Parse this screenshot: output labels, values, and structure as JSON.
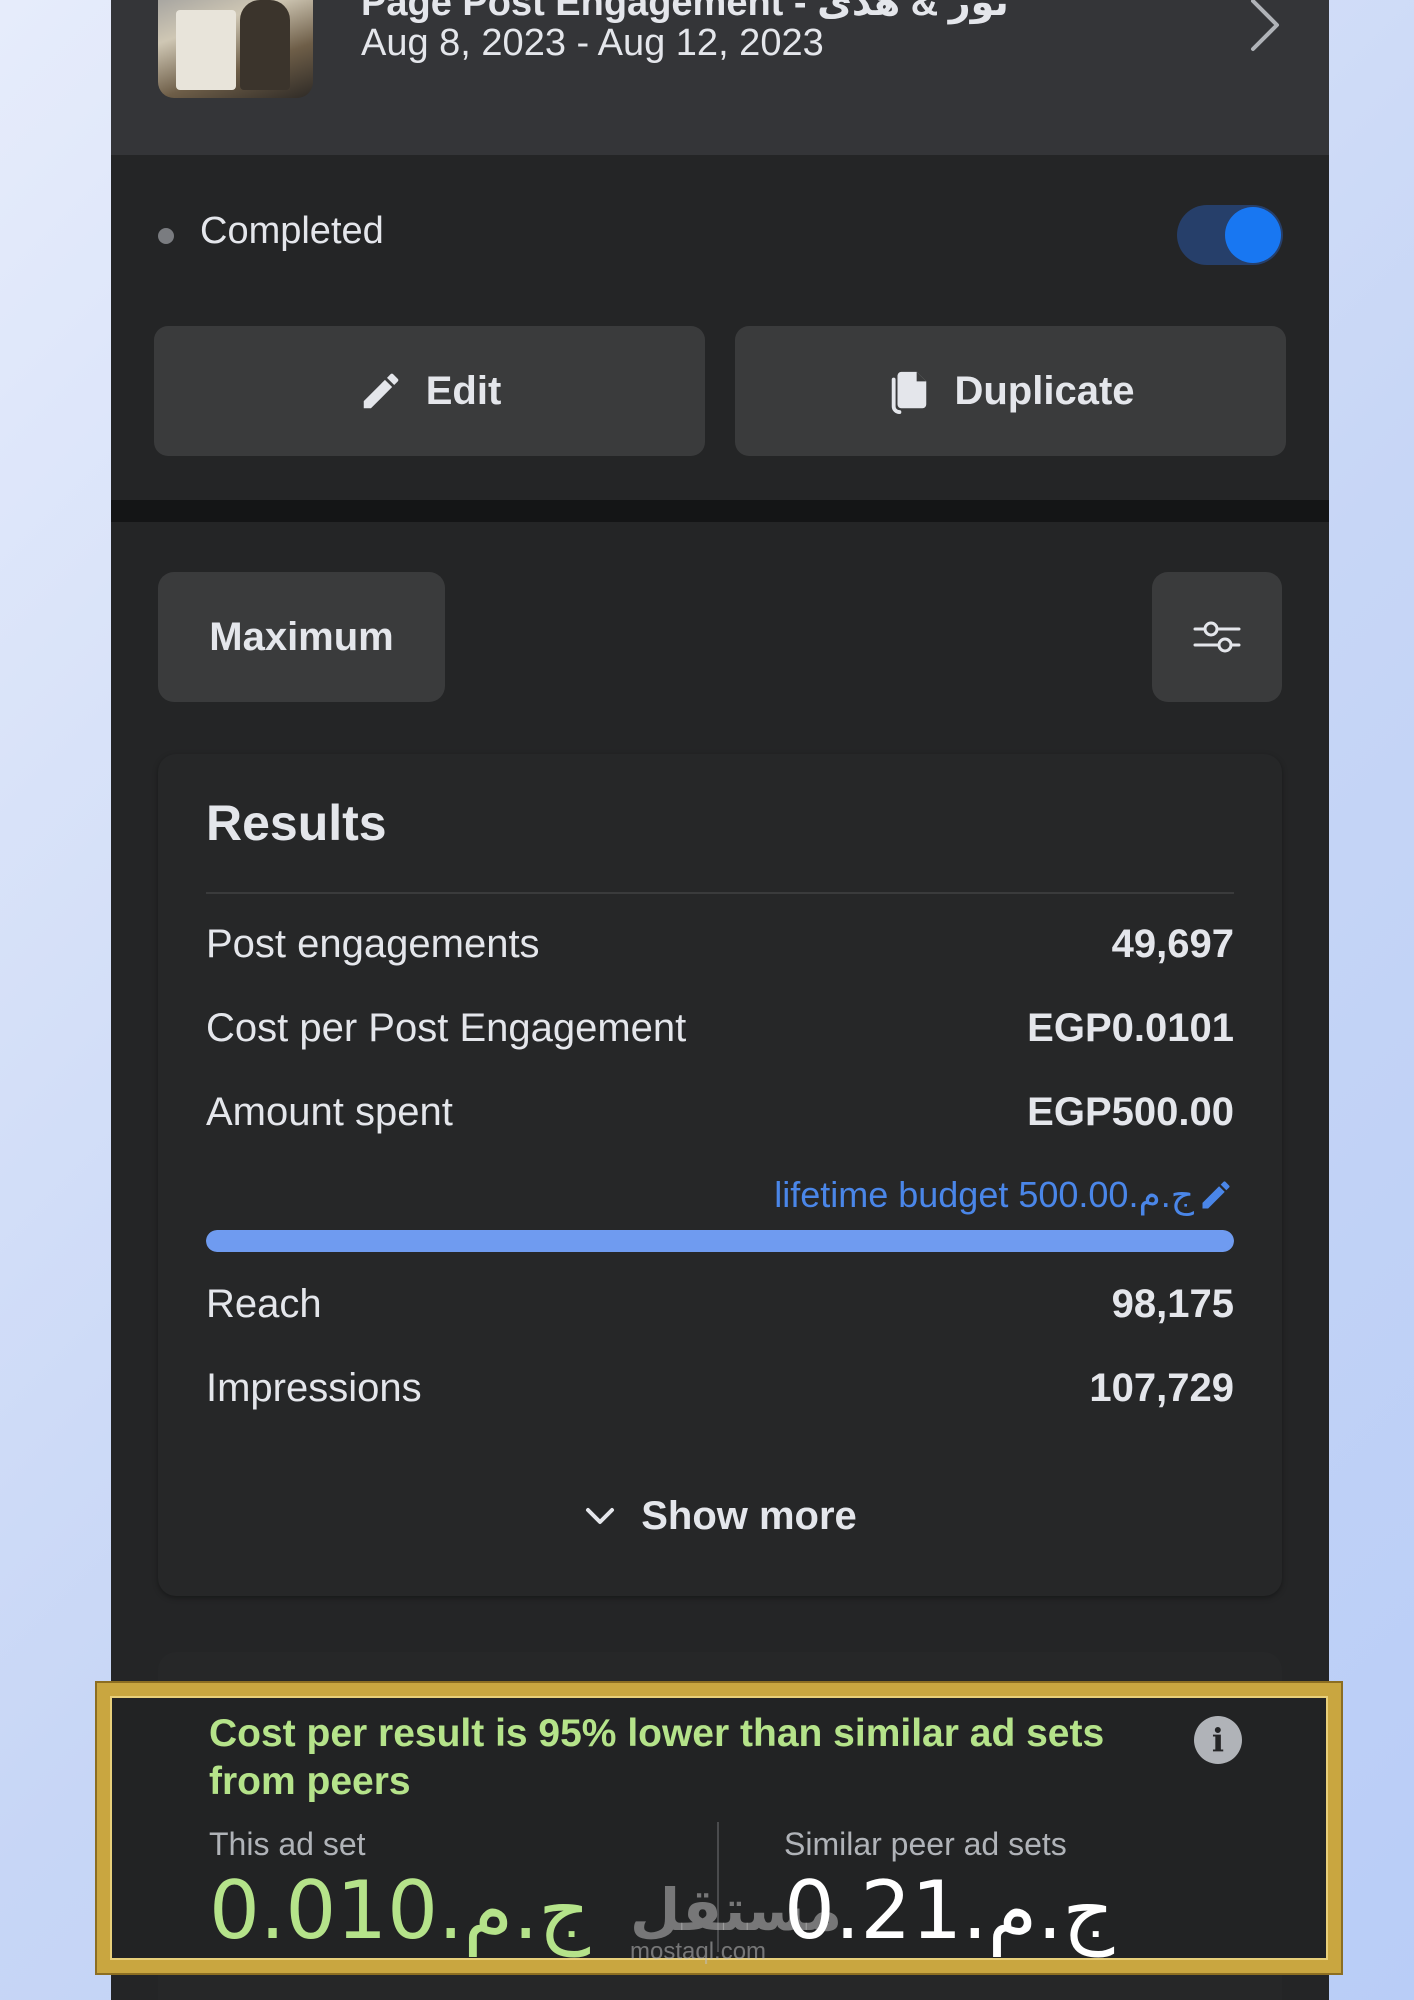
{
  "header": {
    "title": "Page Post Engagement - نور & هدى",
    "date_range": "Aug 8, 2023 - Aug 12, 2023"
  },
  "status": {
    "label": "Completed",
    "toggle_on": true
  },
  "actions": {
    "edit_label": "Edit",
    "duplicate_label": "Duplicate"
  },
  "filter": {
    "range_label": "Maximum",
    "settings_icon": "sliders-icon"
  },
  "results": {
    "title": "Results",
    "rows": [
      {
        "label": "Post engagements",
        "value": "49,697"
      },
      {
        "label": "Cost per Post Engagement",
        "value": "EGP0.0101"
      },
      {
        "label": "Amount spent",
        "value": "EGP500.00"
      }
    ],
    "budget_text": "lifetime budget 500.00.ج.م",
    "budget_progress": 1.0,
    "rows2": [
      {
        "label": "Reach",
        "value": "98,175"
      },
      {
        "label": "Impressions",
        "value": "107,729"
      }
    ],
    "show_more": "Show more"
  },
  "peer": {
    "headline": "Cost per result is 95% lower than similar ad sets from peers",
    "this_label": "This ad set",
    "this_value": "0.010.ج.م",
    "peer_label": "Similar peer ad sets",
    "peer_value": "0.21.ج.م",
    "info_icon": "info-icon"
  },
  "watermark": {
    "text": "مستقل",
    "domain": "mostaql.com"
  },
  "colors": {
    "accent": "#1877f2",
    "link": "#4a86e8",
    "positive": "#b5e38a",
    "frame": "#c9a640"
  }
}
